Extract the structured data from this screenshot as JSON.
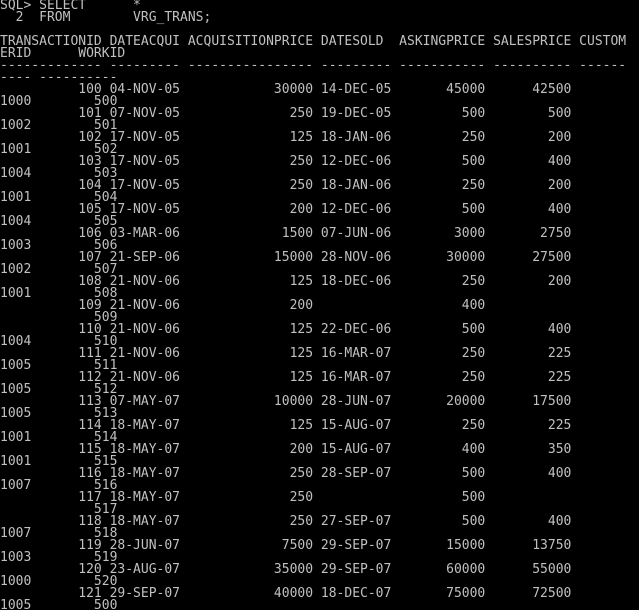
{
  "console": {
    "lines": [
      "SQL> SELECT      *",
      "  2  FROM        VRG_TRANS;",
      "",
      "TRANSACTIONID DATEACQUI ACQUISITIONPRICE DATESOLD  ASKINGPRICE SALESPRICE CUSTOM",
      "ERID      WORKID",
      "------------- --------- ---------------- --------- ----------- ---------- ------",
      "---- ----------",
      "          100 04-NOV-05            30000 14-DEC-05       45000      42500",
      "1000        500",
      "          101 07-NOV-05              250 19-DEC-05         500        500",
      "1002        501",
      "          102 17-NOV-05              125 18-JAN-06         250        200",
      "1001        502",
      "          103 17-NOV-05              250 12-DEC-06         500        400",
      "1004        503",
      "          104 17-NOV-05              250 18-JAN-06         250        200",
      "1001        504",
      "          105 17-NOV-05              200 12-DEC-06         500        400",
      "1004        505",
      "          106 03-MAR-06             1500 07-JUN-06        3000       2750",
      "1003        506",
      "          107 21-SEP-06            15000 28-NOV-06       30000      27500",
      "1002        507",
      "          108 21-NOV-06              125 18-DEC-06         250        200",
      "1001        508",
      "          109 21-NOV-06              200                   400",
      "            509",
      "          110 21-NOV-06              125 22-DEC-06         500        400",
      "1004        510",
      "          111 21-NOV-06              125 16-MAR-07         250        225",
      "1005        511",
      "          112 21-NOV-06              125 16-MAR-07         250        225",
      "1005        512",
      "          113 07-MAY-07            10000 28-JUN-07       20000      17500",
      "1005        513",
      "          114 18-MAY-07              125 15-AUG-07         250        225",
      "1001        514",
      "          115 18-MAY-07              200 15-AUG-07         400        350",
      "1001        515",
      "          116 18-MAY-07              250 28-SEP-07         500        400",
      "1007        516",
      "          117 18-MAY-07              250                   500",
      "            517",
      "          118 18-MAY-07              250 27-SEP-07         500        400",
      "1007        518",
      "          119 28-JUN-07             7500 29-SEP-07       15000      13750",
      "1003        519",
      "          120 23-AUG-07            35000 29-SEP-07       60000      55000",
      "1000        520",
      "          121 29-SEP-07            40000 18-DEC-07       75000      72500",
      "1005        500"
    ]
  },
  "colors": {
    "background": "#000000",
    "text": "#c0c0c0"
  }
}
